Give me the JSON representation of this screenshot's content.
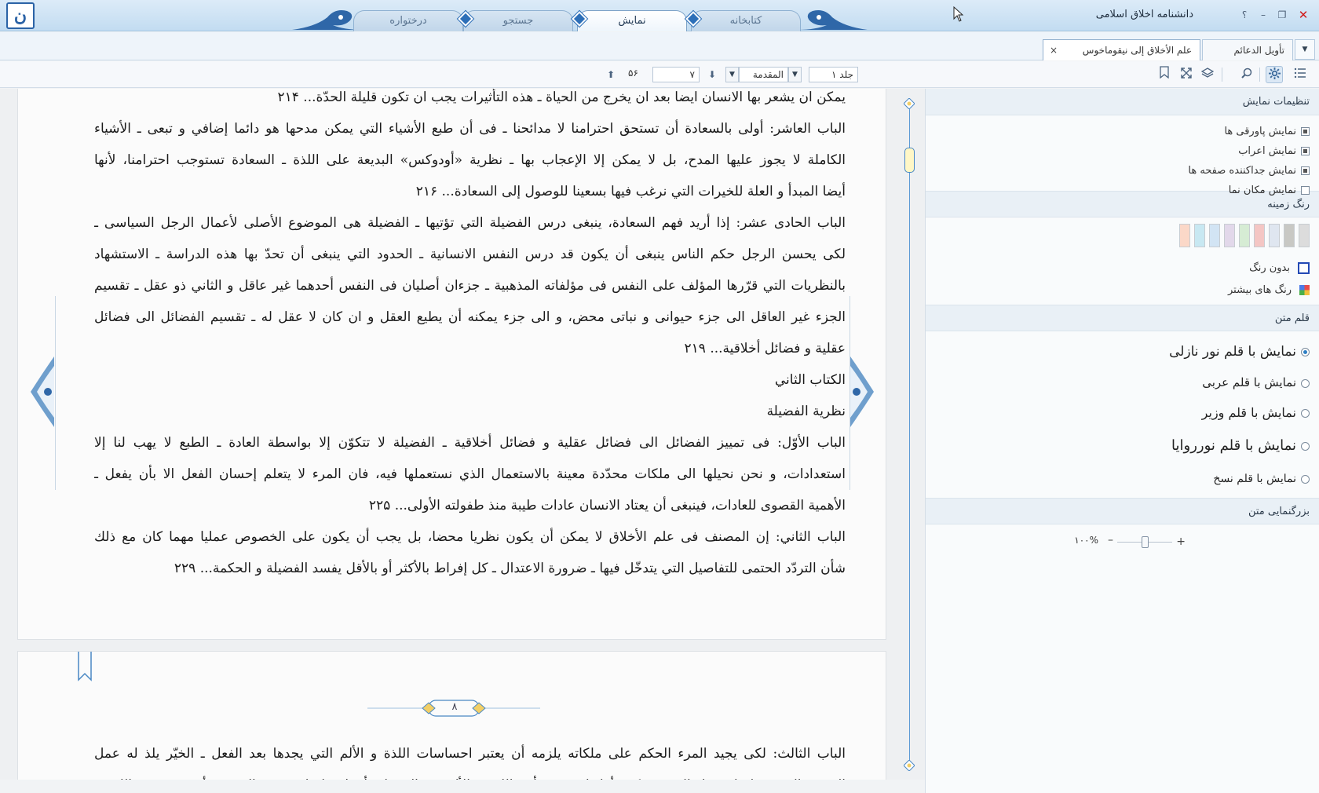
{
  "app": {
    "title": "دانشنامه اخلاق اسلامی",
    "logo_glyph": "ن",
    "window_buttons": {
      "help": "؟",
      "minimize": "–",
      "restore": "❐",
      "maximize": "□",
      "close": "✕"
    }
  },
  "main_tabs": [
    {
      "label": "درختواره",
      "active": false
    },
    {
      "label": "جستجو",
      "active": false
    },
    {
      "label": "نمایش",
      "active": true
    },
    {
      "label": "کتابخانه",
      "active": false
    }
  ],
  "doc_tabs": [
    {
      "label": "تأویل الدعائم",
      "active": false
    },
    {
      "label": "علم الأخلاق إلى نيقوماخوس",
      "active": true,
      "close": "×"
    }
  ],
  "doc_tabs_dropdown": "▼",
  "toolbar": {
    "volume": "جلد ۱",
    "section": "المقدمة",
    "page_input": "۷",
    "total_pages": "۵۶",
    "arrow_down": "▼",
    "prev": "⬆",
    "next": "⬇",
    "icons": [
      "list-icon",
      "gear-icon",
      "search-icon",
      "layers-icon",
      "fullscreen-icon",
      "bookmark-icon"
    ]
  },
  "content": {
    "page1_lines": [
      "يمكن ان يشعر بها الانسان ايضا بعد ان يخرج من الحياة ـ هذه التأثيرات يجب ان تكون قليلة الحدّة... ۲۱۴",
      "الباب العاشر: أولى بالسعادة أن تستحق احترامنا لا مدائحنا ـ فى أن طبع الأشياء التي يمكن مدحها هو دائما إضافي و تبعى ـ الأشياء",
      "الكاملة لا يجوز عليها المدح، بل لا يمكن إلا الإعجاب بها ـ نظرية «أودوكس» البديعة على اللذة ـ السعادة تستوجب احترامنا، لأنها",
      "أيضا المبدأ و العلة للخيرات التي نرغب فيها بسعينا للوصول إلى السعادة... ۲۱۶",
      "الباب الحادى عشر: إذا أريد فهم السعادة، ينبغى درس الفضيلة التي تؤتيها ـ الفضيلة هى الموضوع الأصلى لأعمال الرجل السياسى ـ",
      "لكى يحسن الرجل حكم الناس ينبغى أن يكون قد درس النفس الانسانية ـ الحدود التي ينبغى أن تحدّ بها هذه الدراسة ـ الاستشهاد",
      "بالنظريات التي قرّرها المؤلف على النفس فى مؤلفاته المذهبية ـ جزءان أصليان فى النفس أحدهما غير عاقل و الثاني ذو عقل ـ تقسيم",
      "الجزء غير العاقل الى جزء حيوانى و نباتى محض، و الى جزء يمكنه أن يطيع العقل و ان كان لا عقل له ـ تقسيم الفضائل الى فضائل",
      "عقلية و فضائل أخلاقية... ۲۱۹",
      "الكتاب الثاني",
      "نظرية الفضيلة",
      "الباب الأوّل: فى تمييز الفضائل الى فضائل عقلية و فضائل أخلاقية ـ الفضيلة لا تتكوّن إلا بواسطة العادة ـ الطبع لا يهب لنا إلا",
      "استعدادات، و نحن نحيلها الى ملكات محدّدة معينة بالاستعمال الذي نستعملها فيه، فان المرء لا يتعلم إحسان الفعل الا بأن يفعل ـ",
      "الأهمية القصوى للعادات، فينبغى أن يعتاد الانسان عادات طيبة منذ طفولته الأولى... ۲۲۵",
      "الباب الثاني: إن المصنف فى علم الأخلاق لا يمكن أن يكون نظريا محضا، بل يجب أن يكون على الخصوص عمليا مهما كان مع ذلك",
      "شأن التردّد الحتمى للتفاصيل التي يتدخّل فيها ـ ضرورة الاعتدال ـ كل إفراط بالأكثر أو بالأقل يفسد الفضيلة و الحكمة... ۲۲۹"
    ],
    "page2_number": "۸",
    "page2_lines": [
      "الباب الثالث: لكى يجيد المرء الحكم على ملكاته يلزمه أن يعتبر احساسات اللذة و الألم التي يجدها بعد الفعل ـ الخيّر يلذ له عمل",
      "الخير و الشرير يلذ له عمل الشر ـ حكمة أفلاطون فى تأثير اللذة و الألم فى الفضيلة تأثيرا عظيما ـ حسن التصرف أو سوءه فى اللذة و"
    ]
  },
  "panel": {
    "display_settings": {
      "heading": "تنظیمات نمایش",
      "options": [
        {
          "label": "نمایش پاورقی ها",
          "checked": true
        },
        {
          "label": "نمایش اعراب",
          "checked": true
        },
        {
          "label": "نمایش جداکننده صفحه ها",
          "checked": true
        },
        {
          "label": "نمایش مکان نما",
          "checked": false
        }
      ]
    },
    "background_color": {
      "heading": "رنگ زمینه",
      "swatches": [
        "#dcdcdc",
        "#c8c8c4",
        "#dfe6f0",
        "#f4c6c4",
        "#d6ecd4",
        "#e2d8ea",
        "#d2e4f4",
        "#c8e8f2",
        "#fbd8c8"
      ],
      "no_color": "بدون رنگ",
      "more_colors": "رنگ های بیشتر"
    },
    "text_font": {
      "heading": "قلم متن",
      "options": [
        {
          "label": "نمایش با قلم نور نازلی",
          "selected": true
        },
        {
          "label": "نمایش با قلم عربی",
          "selected": false
        },
        {
          "label": "نمایش با قلم وزیر",
          "selected": false
        },
        {
          "label": "نمایش با قلم نورروایا",
          "selected": false
        },
        {
          "label": "نمایش با قلم نسخ",
          "selected": false
        }
      ]
    },
    "zoom": {
      "heading": "بزرگنمایی متن",
      "value": "۱۰۰%",
      "minus": "–",
      "plus": "+",
      "level_percent": 100
    }
  }
}
